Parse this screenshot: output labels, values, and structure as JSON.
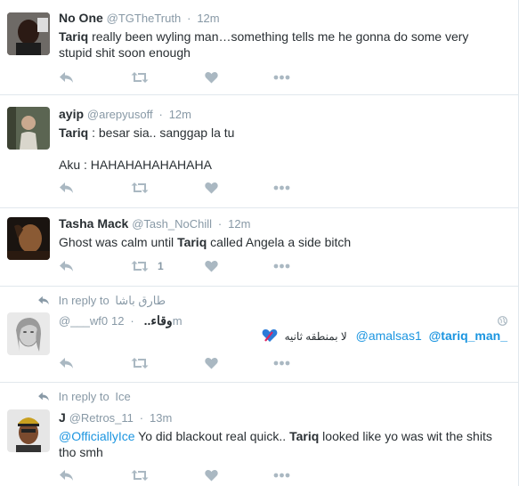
{
  "colors": {
    "accent": "#1b95e0",
    "muted": "#8899a6",
    "text": "#292f33",
    "border": "#e1e8ed",
    "heart_emoji": "#e0245e"
  },
  "icons": {
    "reply": "reply-arrow-icon",
    "retweet": "retweet-icon",
    "like": "heart-icon",
    "more": "more-dots-icon",
    "globe": "globe-icon",
    "heart_emoji": "blue-heart-emoji-icon"
  },
  "tweets": [
    {
      "fullname": "No One",
      "username": "@TGTheTruth",
      "time": "12m",
      "bold": "Tariq",
      "text": " really been wyling man…something tells me he gonna do some very",
      "text2": "stupid shit soon enough"
    },
    {
      "fullname": "ayip",
      "username": "@arepyusoff",
      "time": "12m",
      "bold": "Tariq",
      "text": " : besar sia..  sanggap la tu",
      "text2": "Aku : HAHAHAHAHAHAHA"
    },
    {
      "fullname": "Tasha Mack",
      "username": "@Tash_NoChill",
      "time": "12m",
      "pre": "Ghost was calm until ",
      "bold": "Tariq",
      "post": " called Angela a side bitch",
      "retweet_count": "1"
    },
    {
      "reply_label": "In reply to",
      "reply_name": "طارق باشا",
      "fullname": "وقاء..",
      "username": "@___wf0",
      "time": "12m",
      "arabic": "لا بمنطقه ثانيه",
      "mention1": "@amalsas1",
      "mention2": "@tariq_man_"
    },
    {
      "reply_label": "In reply to",
      "reply_name": "Ice",
      "fullname": "J",
      "username": "@Retros_11",
      "time": "13m",
      "mention": "@OfficiallyIce",
      "pre": " Yo did blackout real quick.. ",
      "bold": "Tariq",
      "post": " looked like yo was wit the shits",
      "text2": "tho smh"
    }
  ]
}
